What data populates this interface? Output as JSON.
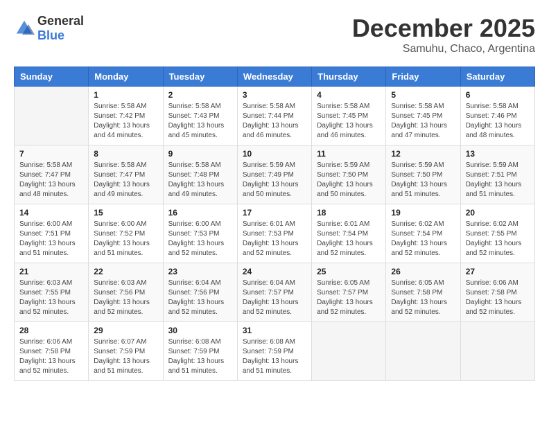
{
  "header": {
    "logo_general": "General",
    "logo_blue": "Blue",
    "month_year": "December 2025",
    "location": "Samuhu, Chaco, Argentina"
  },
  "days_of_week": [
    "Sunday",
    "Monday",
    "Tuesday",
    "Wednesday",
    "Thursday",
    "Friday",
    "Saturday"
  ],
  "weeks": [
    [
      {
        "day": "",
        "sunrise": "",
        "sunset": "",
        "daylight": ""
      },
      {
        "day": "1",
        "sunrise": "Sunrise: 5:58 AM",
        "sunset": "Sunset: 7:42 PM",
        "daylight": "Daylight: 13 hours and 44 minutes."
      },
      {
        "day": "2",
        "sunrise": "Sunrise: 5:58 AM",
        "sunset": "Sunset: 7:43 PM",
        "daylight": "Daylight: 13 hours and 45 minutes."
      },
      {
        "day": "3",
        "sunrise": "Sunrise: 5:58 AM",
        "sunset": "Sunset: 7:44 PM",
        "daylight": "Daylight: 13 hours and 46 minutes."
      },
      {
        "day": "4",
        "sunrise": "Sunrise: 5:58 AM",
        "sunset": "Sunset: 7:45 PM",
        "daylight": "Daylight: 13 hours and 46 minutes."
      },
      {
        "day": "5",
        "sunrise": "Sunrise: 5:58 AM",
        "sunset": "Sunset: 7:45 PM",
        "daylight": "Daylight: 13 hours and 47 minutes."
      },
      {
        "day": "6",
        "sunrise": "Sunrise: 5:58 AM",
        "sunset": "Sunset: 7:46 PM",
        "daylight": "Daylight: 13 hours and 48 minutes."
      }
    ],
    [
      {
        "day": "7",
        "sunrise": "Sunrise: 5:58 AM",
        "sunset": "Sunset: 7:47 PM",
        "daylight": "Daylight: 13 hours and 48 minutes."
      },
      {
        "day": "8",
        "sunrise": "Sunrise: 5:58 AM",
        "sunset": "Sunset: 7:47 PM",
        "daylight": "Daylight: 13 hours and 49 minutes."
      },
      {
        "day": "9",
        "sunrise": "Sunrise: 5:58 AM",
        "sunset": "Sunset: 7:48 PM",
        "daylight": "Daylight: 13 hours and 49 minutes."
      },
      {
        "day": "10",
        "sunrise": "Sunrise: 5:59 AM",
        "sunset": "Sunset: 7:49 PM",
        "daylight": "Daylight: 13 hours and 50 minutes."
      },
      {
        "day": "11",
        "sunrise": "Sunrise: 5:59 AM",
        "sunset": "Sunset: 7:50 PM",
        "daylight": "Daylight: 13 hours and 50 minutes."
      },
      {
        "day": "12",
        "sunrise": "Sunrise: 5:59 AM",
        "sunset": "Sunset: 7:50 PM",
        "daylight": "Daylight: 13 hours and 51 minutes."
      },
      {
        "day": "13",
        "sunrise": "Sunrise: 5:59 AM",
        "sunset": "Sunset: 7:51 PM",
        "daylight": "Daylight: 13 hours and 51 minutes."
      }
    ],
    [
      {
        "day": "14",
        "sunrise": "Sunrise: 6:00 AM",
        "sunset": "Sunset: 7:51 PM",
        "daylight": "Daylight: 13 hours and 51 minutes."
      },
      {
        "day": "15",
        "sunrise": "Sunrise: 6:00 AM",
        "sunset": "Sunset: 7:52 PM",
        "daylight": "Daylight: 13 hours and 51 minutes."
      },
      {
        "day": "16",
        "sunrise": "Sunrise: 6:00 AM",
        "sunset": "Sunset: 7:53 PM",
        "daylight": "Daylight: 13 hours and 52 minutes."
      },
      {
        "day": "17",
        "sunrise": "Sunrise: 6:01 AM",
        "sunset": "Sunset: 7:53 PM",
        "daylight": "Daylight: 13 hours and 52 minutes."
      },
      {
        "day": "18",
        "sunrise": "Sunrise: 6:01 AM",
        "sunset": "Sunset: 7:54 PM",
        "daylight": "Daylight: 13 hours and 52 minutes."
      },
      {
        "day": "19",
        "sunrise": "Sunrise: 6:02 AM",
        "sunset": "Sunset: 7:54 PM",
        "daylight": "Daylight: 13 hours and 52 minutes."
      },
      {
        "day": "20",
        "sunrise": "Sunrise: 6:02 AM",
        "sunset": "Sunset: 7:55 PM",
        "daylight": "Daylight: 13 hours and 52 minutes."
      }
    ],
    [
      {
        "day": "21",
        "sunrise": "Sunrise: 6:03 AM",
        "sunset": "Sunset: 7:55 PM",
        "daylight": "Daylight: 13 hours and 52 minutes."
      },
      {
        "day": "22",
        "sunrise": "Sunrise: 6:03 AM",
        "sunset": "Sunset: 7:56 PM",
        "daylight": "Daylight: 13 hours and 52 minutes."
      },
      {
        "day": "23",
        "sunrise": "Sunrise: 6:04 AM",
        "sunset": "Sunset: 7:56 PM",
        "daylight": "Daylight: 13 hours and 52 minutes."
      },
      {
        "day": "24",
        "sunrise": "Sunrise: 6:04 AM",
        "sunset": "Sunset: 7:57 PM",
        "daylight": "Daylight: 13 hours and 52 minutes."
      },
      {
        "day": "25",
        "sunrise": "Sunrise: 6:05 AM",
        "sunset": "Sunset: 7:57 PM",
        "daylight": "Daylight: 13 hours and 52 minutes."
      },
      {
        "day": "26",
        "sunrise": "Sunrise: 6:05 AM",
        "sunset": "Sunset: 7:58 PM",
        "daylight": "Daylight: 13 hours and 52 minutes."
      },
      {
        "day": "27",
        "sunrise": "Sunrise: 6:06 AM",
        "sunset": "Sunset: 7:58 PM",
        "daylight": "Daylight: 13 hours and 52 minutes."
      }
    ],
    [
      {
        "day": "28",
        "sunrise": "Sunrise: 6:06 AM",
        "sunset": "Sunset: 7:58 PM",
        "daylight": "Daylight: 13 hours and 52 minutes."
      },
      {
        "day": "29",
        "sunrise": "Sunrise: 6:07 AM",
        "sunset": "Sunset: 7:59 PM",
        "daylight": "Daylight: 13 hours and 51 minutes."
      },
      {
        "day": "30",
        "sunrise": "Sunrise: 6:08 AM",
        "sunset": "Sunset: 7:59 PM",
        "daylight": "Daylight: 13 hours and 51 minutes."
      },
      {
        "day": "31",
        "sunrise": "Sunrise: 6:08 AM",
        "sunset": "Sunset: 7:59 PM",
        "daylight": "Daylight: 13 hours and 51 minutes."
      },
      {
        "day": "",
        "sunrise": "",
        "sunset": "",
        "daylight": ""
      },
      {
        "day": "",
        "sunrise": "",
        "sunset": "",
        "daylight": ""
      },
      {
        "day": "",
        "sunrise": "",
        "sunset": "",
        "daylight": ""
      }
    ]
  ]
}
